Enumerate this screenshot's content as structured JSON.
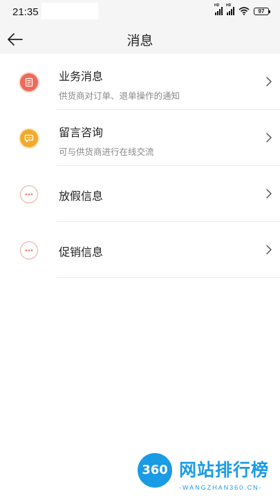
{
  "status_bar": {
    "time": "21:35",
    "signal1_label": "HD",
    "signal2_label": "HD",
    "battery": "97"
  },
  "header": {
    "title": "消息"
  },
  "messages": [
    {
      "title": "业务消息",
      "subtitle": "供货商对订单、退单操作的通知",
      "icon": "document-icon",
      "icon_color": "#ee6a5a"
    },
    {
      "title": "留言咨询",
      "subtitle": "可与供货商进行在线交流",
      "icon": "chat-bubble-icon",
      "icon_color": "#f3a92a"
    },
    {
      "title": "放假信息",
      "icon": "more-dots-icon",
      "icon_color": "#e8a79e"
    },
    {
      "title": "促销信息",
      "icon": "more-dots-icon",
      "icon_color": "#e8a79e"
    }
  ],
  "watermark": {
    "logo_text": "360",
    "title": "网站排行榜",
    "url": "-WANGZHAN360.CN-",
    "color": "#1a9be6"
  }
}
